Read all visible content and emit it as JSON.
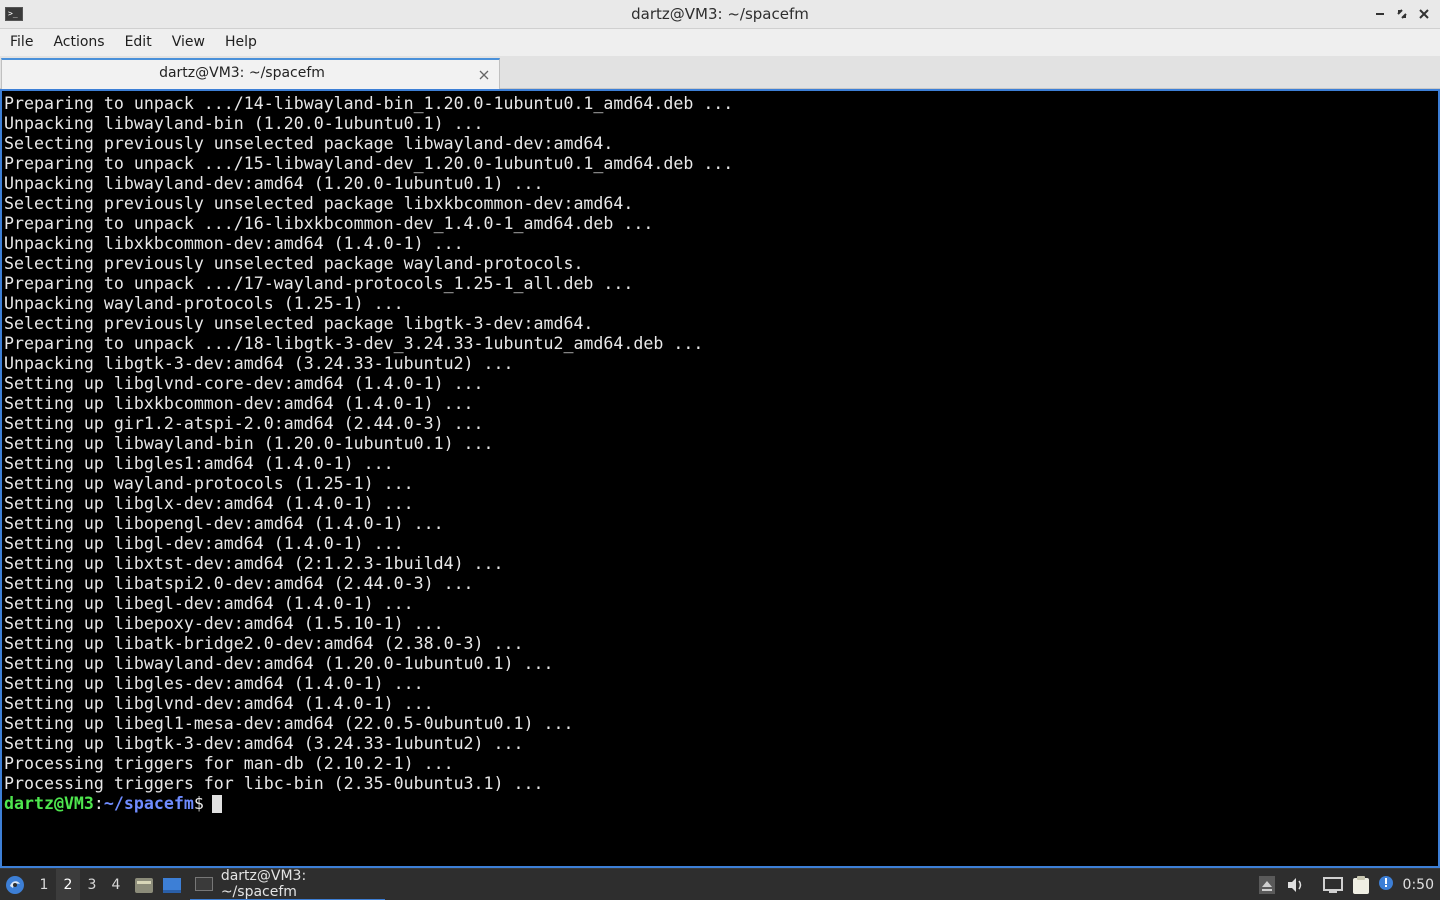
{
  "window": {
    "title": "dartz@VM3: ~/spacefm",
    "buttons": [
      "minimize-icon",
      "restore-icon",
      "close-icon"
    ]
  },
  "menubar": {
    "items": [
      {
        "label": "File"
      },
      {
        "label": "Actions"
      },
      {
        "label": "Edit"
      },
      {
        "label": "View"
      },
      {
        "label": "Help"
      }
    ]
  },
  "tab": {
    "label": "dartz@VM3: ~/spacefm",
    "close_icon": "close-icon"
  },
  "terminal": {
    "lines": [
      "Preparing to unpack .../14-libwayland-bin_1.20.0-1ubuntu0.1_amd64.deb ...",
      "Unpacking libwayland-bin (1.20.0-1ubuntu0.1) ...",
      "Selecting previously unselected package libwayland-dev:amd64.",
      "Preparing to unpack .../15-libwayland-dev_1.20.0-1ubuntu0.1_amd64.deb ...",
      "Unpacking libwayland-dev:amd64 (1.20.0-1ubuntu0.1) ...",
      "Selecting previously unselected package libxkbcommon-dev:amd64.",
      "Preparing to unpack .../16-libxkbcommon-dev_1.4.0-1_amd64.deb ...",
      "Unpacking libxkbcommon-dev:amd64 (1.4.0-1) ...",
      "Selecting previously unselected package wayland-protocols.",
      "Preparing to unpack .../17-wayland-protocols_1.25-1_all.deb ...",
      "Unpacking wayland-protocols (1.25-1) ...",
      "Selecting previously unselected package libgtk-3-dev:amd64.",
      "Preparing to unpack .../18-libgtk-3-dev_3.24.33-1ubuntu2_amd64.deb ...",
      "Unpacking libgtk-3-dev:amd64 (3.24.33-1ubuntu2) ...",
      "Setting up libglvnd-core-dev:amd64 (1.4.0-1) ...",
      "Setting up libxkbcommon-dev:amd64 (1.4.0-1) ...",
      "Setting up gir1.2-atspi-2.0:amd64 (2.44.0-3) ...",
      "Setting up libwayland-bin (1.20.0-1ubuntu0.1) ...",
      "Setting up libgles1:amd64 (1.4.0-1) ...",
      "Setting up wayland-protocols (1.25-1) ...",
      "Setting up libglx-dev:amd64 (1.4.0-1) ...",
      "Setting up libopengl-dev:amd64 (1.4.0-1) ...",
      "Setting up libgl-dev:amd64 (1.4.0-1) ...",
      "Setting up libxtst-dev:amd64 (2:1.2.3-1build4) ...",
      "Setting up libatspi2.0-dev:amd64 (2.44.0-3) ...",
      "Setting up libegl-dev:amd64 (1.4.0-1) ...",
      "Setting up libepoxy-dev:amd64 (1.5.10-1) ...",
      "Setting up libatk-bridge2.0-dev:amd64 (2.38.0-3) ...",
      "Setting up libwayland-dev:amd64 (1.20.0-1ubuntu0.1) ...",
      "Setting up libgles-dev:amd64 (1.4.0-1) ...",
      "Setting up libglvnd-dev:amd64 (1.4.0-1) ...",
      "Setting up libegl1-mesa-dev:amd64 (22.0.5-0ubuntu0.1) ...",
      "Setting up libgtk-3-dev:amd64 (3.24.33-1ubuntu2) ...",
      "Processing triggers for man-db (2.10.2-1) ...",
      "Processing triggers for libc-bin (2.35-0ubuntu3.1) ..."
    ],
    "prompt": {
      "user_host": "dartz@VM3",
      "separator": ":",
      "path": "~/spacefm",
      "symbol": "$"
    },
    "colors": {
      "background": "#000000",
      "text": "#e8e8e8",
      "prompt_user": "#4ee64e",
      "prompt_path": "#6f8cff",
      "border": "#3d7fd6"
    }
  },
  "taskbar": {
    "start_icon": "lxqt-start-icon",
    "desktops": [
      {
        "label": "1"
      },
      {
        "label": "2",
        "active": true
      },
      {
        "label": "3"
      },
      {
        "label": "4"
      }
    ],
    "quicklaunch": [
      "file-manager-icon",
      "show-desktop-icon"
    ],
    "task": {
      "label": "dartz@VM3: ~/spacefm",
      "icon": "terminal-icon"
    },
    "tray": [
      "eject-icon",
      "volume-icon",
      "network-icon",
      "clipboard-icon",
      "notification-icon"
    ],
    "clock": "0:50"
  }
}
